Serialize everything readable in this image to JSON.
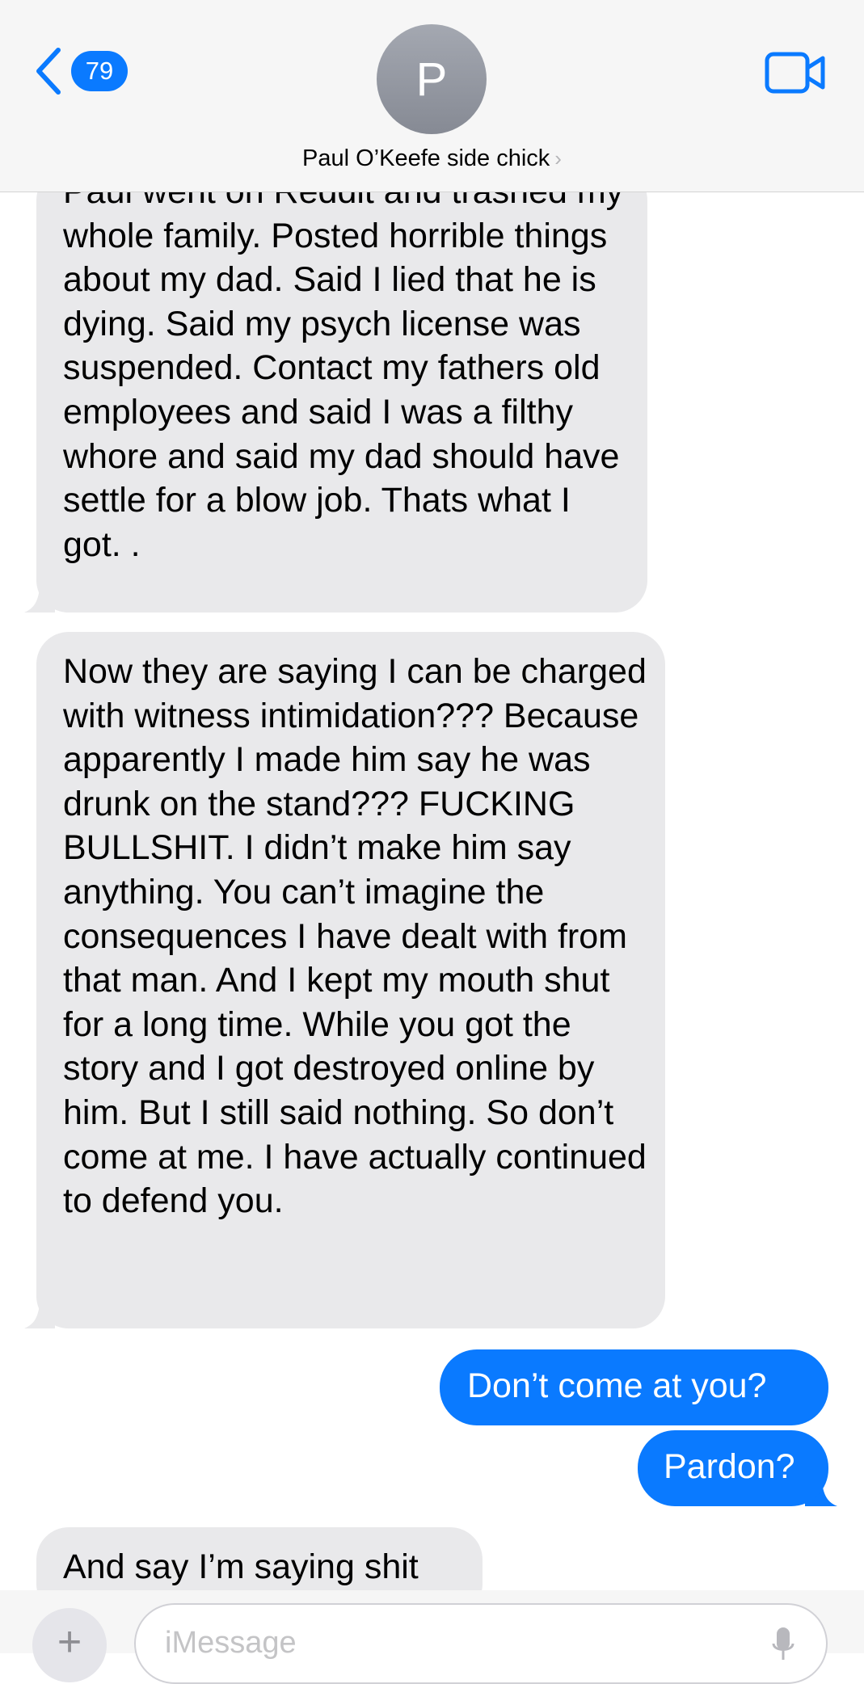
{
  "header": {
    "back_count": "79",
    "avatar_initial": "P",
    "contact_name": "Paul O’Keefe side chick",
    "contact_chevron": "›",
    "video_icon": "video-camera-icon",
    "back_icon": "chevron-left-icon"
  },
  "messages": [
    {
      "direction": "incoming",
      "text": "Paul went on Reddit and trashed my whole family. Posted horrible things about my dad. Said I lied that he is dying. Said my psych license was suspended. Contact my fathers old employees and said I was a filthy whore and said my dad should have settle for a blow job. Thats what I got.  ."
    },
    {
      "direction": "incoming",
      "text": "Now they are saying I can be charged with witness intimidation??? Because apparently I made him say he was drunk on the stand??? FUCKING BULLSHIT. I didn’t make him say anything. You can’t imagine the consequences I have dealt with from that man. And I kept my mouth shut for a long time. While you got the story and  I got destroyed online by him. But I still said nothing. So don’t come at me. I have actually continued to defend you."
    },
    {
      "direction": "outgoing",
      "text": "Don’t come at you?"
    },
    {
      "direction": "outgoing",
      "text": "Pardon?"
    },
    {
      "direction": "incoming",
      "text": "And say I’m saying shit"
    }
  ],
  "composer": {
    "placeholder": "iMessage",
    "plus_label": "+",
    "mic_icon": "microphone-icon"
  },
  "colors": {
    "accent": "#0a7aff",
    "incoming_bubble": "#e9e9eb",
    "header_bg": "#f6f6f6"
  }
}
